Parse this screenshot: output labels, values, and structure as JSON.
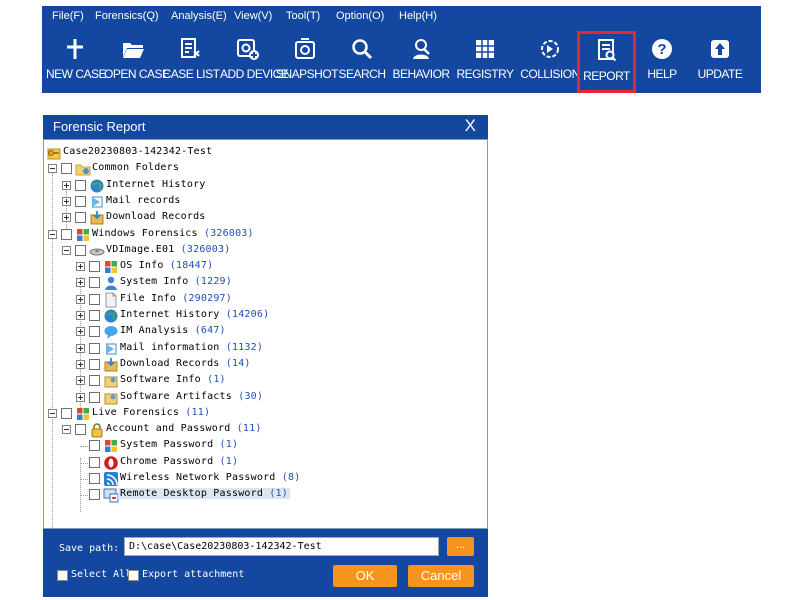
{
  "menu": [
    "File(F)",
    "Forensics(Q)",
    "Analysis(E)",
    "View(V)",
    "Tool(T)",
    "Option(O)",
    "Help(H)"
  ],
  "toolbar": [
    {
      "label": "NEW CASE",
      "icon": "plus-icon"
    },
    {
      "label": "OPEN CASE",
      "icon": "folder-open-icon"
    },
    {
      "label": "CASE LIST",
      "icon": "case-list-icon"
    },
    {
      "label": "ADD DEVICE",
      "icon": "add-device-icon"
    },
    {
      "label": "SNAPSHOT",
      "icon": "snapshot-icon"
    },
    {
      "label": "SEARCH",
      "icon": "search-icon"
    },
    {
      "label": "BEHAVIOR",
      "icon": "behavior-icon"
    },
    {
      "label": "REGISTRY",
      "icon": "registry-icon"
    },
    {
      "label": "COLLISION",
      "icon": "collision-icon"
    },
    {
      "label": "REPORT",
      "icon": "report-icon",
      "active": true
    },
    {
      "label": "HELP",
      "icon": "help-icon"
    },
    {
      "label": "UPDATE",
      "icon": "update-icon"
    }
  ],
  "dialog": {
    "title": "Forensic Report",
    "close": "X",
    "tree": [
      {
        "label": "Case20230803-142342-Test",
        "count": "",
        "icon": "key-folder-icon",
        "level": 0,
        "expander": "none",
        "checkbox": false
      },
      {
        "label": "Common Folders",
        "count": "",
        "icon": "folder-icon",
        "level": 0,
        "expander": "minus",
        "checkbox": true
      },
      {
        "label": "Internet History",
        "count": "",
        "icon": "globe-icon",
        "level": 1,
        "expander": "plus",
        "checkbox": true
      },
      {
        "label": "Mail records",
        "count": "",
        "icon": "mail-icon",
        "level": 1,
        "expander": "plus",
        "checkbox": true
      },
      {
        "label": "Download Records",
        "count": "",
        "icon": "download-icon",
        "level": 1,
        "expander": "plus",
        "checkbox": true
      },
      {
        "label": "Windows Forensics",
        "count": "(326003)",
        "icon": "windows-icon",
        "level": 0,
        "expander": "minus",
        "checkbox": true
      },
      {
        "label": "VDImage.E01",
        "count": "(326003)",
        "icon": "disk-image-icon",
        "level": 1,
        "expander": "minus",
        "checkbox": true
      },
      {
        "label": "OS Info",
        "count": "(18447)",
        "icon": "windows-icon",
        "level": 2,
        "expander": "plus",
        "checkbox": true
      },
      {
        "label": "System Info",
        "count": "(1229)",
        "icon": "user-icon",
        "level": 2,
        "expander": "plus",
        "checkbox": true
      },
      {
        "label": "File Info",
        "count": "(290297)",
        "icon": "file-icon",
        "level": 2,
        "expander": "plus",
        "checkbox": true
      },
      {
        "label": "Internet History",
        "count": "(14206)",
        "icon": "globe-icon",
        "level": 2,
        "expander": "plus",
        "checkbox": true
      },
      {
        "label": "IM Analysis",
        "count": "(647)",
        "icon": "chat-icon",
        "level": 2,
        "expander": "plus",
        "checkbox": true
      },
      {
        "label": "Mail information",
        "count": "(1132)",
        "icon": "mail-icon",
        "level": 2,
        "expander": "plus",
        "checkbox": true
      },
      {
        "label": "Download Records",
        "count": "(14)",
        "icon": "download-icon",
        "level": 2,
        "expander": "plus",
        "checkbox": true
      },
      {
        "label": "Software Info",
        "count": "(1)",
        "icon": "software-icon",
        "level": 2,
        "expander": "plus",
        "checkbox": true
      },
      {
        "label": "Software Artifacts",
        "count": "(30)",
        "icon": "software-icon",
        "level": 2,
        "expander": "plus",
        "checkbox": true
      },
      {
        "label": "Live Forensics",
        "count": "(11)",
        "icon": "windows-icon",
        "level": 0,
        "expander": "minus",
        "checkbox": true
      },
      {
        "label": "Account and Password",
        "count": "(11)",
        "icon": "lock-icon",
        "level": 1,
        "expander": "minus",
        "checkbox": true
      },
      {
        "label": "System Password",
        "count": "(1)",
        "icon": "windows-icon",
        "level": 2,
        "expander": "none",
        "checkbox": true
      },
      {
        "label": "Chrome Password",
        "count": "(1)",
        "icon": "opera-icon",
        "level": 2,
        "expander": "none",
        "checkbox": true
      },
      {
        "label": "Wireless Network Password",
        "count": "(8)",
        "icon": "wifi-icon",
        "level": 2,
        "expander": "none",
        "checkbox": true
      },
      {
        "label": "Remote Desktop Password",
        "count": "(1)",
        "icon": "remote-desktop-icon",
        "level": 2,
        "expander": "none",
        "checkbox": true,
        "selected": true
      }
    ],
    "save_path_label": "Save path:",
    "save_path_value": "D:\\case\\Case20230803-142342-Test",
    "browse_label": "...",
    "select_all_label": "Select All",
    "export_attachment_label": "Export attachment",
    "ok_label": "OK",
    "cancel_label": "Cancel"
  },
  "colors": {
    "brand_blue": "#1448a0",
    "accent_orange": "#f7941d",
    "active_border": "#e8262b",
    "count_blue": "#1f4fb4"
  }
}
